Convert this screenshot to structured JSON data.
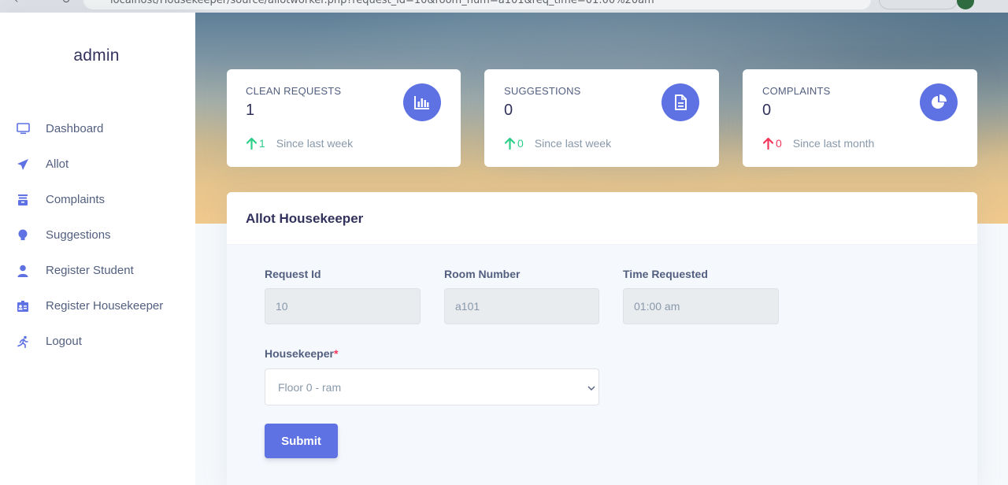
{
  "browser": {
    "url": "localhost/Housekeeper/source/allotworker.php?request_id=10&room_num=a101&req_time=01:00%20am"
  },
  "sidebar": {
    "brand": "admin",
    "items": [
      {
        "label": "Dashboard",
        "icon": "monitor-icon"
      },
      {
        "label": "Allot",
        "icon": "paper-plane-icon"
      },
      {
        "label": "Complaints",
        "icon": "archive-icon"
      },
      {
        "label": "Suggestions",
        "icon": "bulb-icon"
      },
      {
        "label": "Register Student",
        "icon": "user-icon"
      },
      {
        "label": "Register Housekeeper",
        "icon": "badge-icon"
      },
      {
        "label": "Logout",
        "icon": "running-icon"
      }
    ]
  },
  "stats": [
    {
      "title": "CLEAN REQUESTS",
      "value": "1",
      "change": "1",
      "direction": "up",
      "since": "Since last week",
      "icon": "chart-bar-icon",
      "color": "#2dce89"
    },
    {
      "title": "SUGGESTIONS",
      "value": "0",
      "change": "0",
      "direction": "up",
      "since": "Since last week",
      "icon": "document-icon",
      "color": "#2dce89"
    },
    {
      "title": "COMPLAINTS",
      "value": "0",
      "change": "0",
      "direction": "up",
      "since": "Since last month",
      "icon": "pie-chart-icon",
      "color": "#f5365c"
    }
  ],
  "form": {
    "title": "Allot Housekeeper",
    "request_id_label": "Request Id",
    "request_id_value": "10",
    "room_number_label": "Room Number",
    "room_number_value": "a101",
    "time_requested_label": "Time Requested",
    "time_requested_value": "01:00 am",
    "housekeeper_label": "Housekeeper",
    "housekeeper_required": "*",
    "housekeeper_selected": "Floor 0 - ram",
    "submit_label": "Submit"
  },
  "colors": {
    "accent": "#5e72e4",
    "success": "#2dce89",
    "danger": "#f5365c"
  }
}
